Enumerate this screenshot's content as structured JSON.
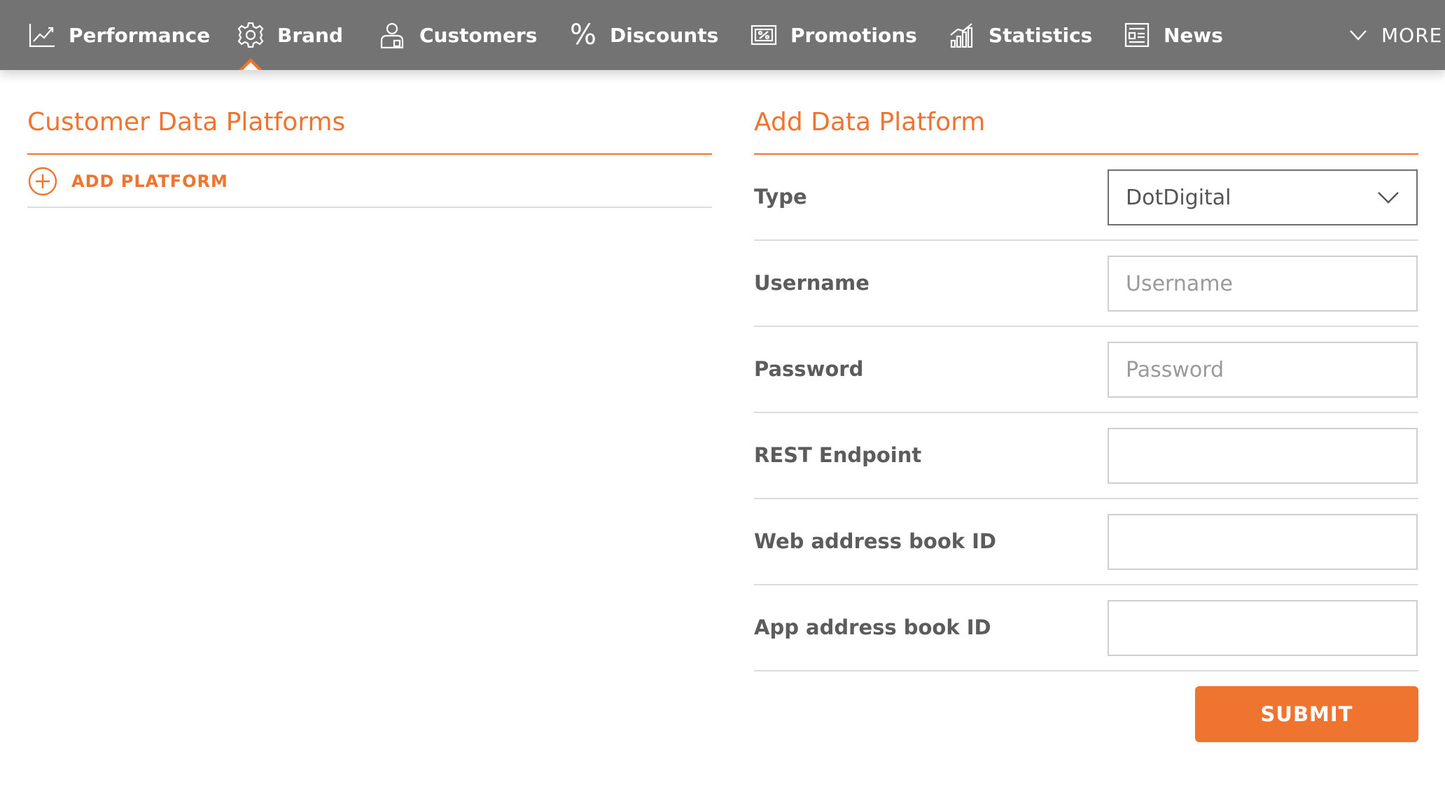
{
  "nav": {
    "items": [
      {
        "label": "Performance",
        "icon": "chart-line-icon"
      },
      {
        "label": "Brand",
        "icon": "gear-icon"
      },
      {
        "label": "Customers",
        "icon": "customer-icon"
      },
      {
        "label": "Discounts",
        "icon": "percent-icon"
      },
      {
        "label": "Promotions",
        "icon": "promotion-ticket-icon"
      },
      {
        "label": "Statistics",
        "icon": "bar-chart-icon"
      },
      {
        "label": "News",
        "icon": "news-icon"
      }
    ],
    "active": "Brand",
    "more_label": "MORE"
  },
  "left_panel": {
    "title": "Customer Data Platforms",
    "add_label": "ADD PLATFORM"
  },
  "form": {
    "title": "Add Data Platform",
    "type_label": "Type",
    "type_value": "DotDigital",
    "username_label": "Username",
    "username_placeholder": "Username",
    "password_label": "Password",
    "password_placeholder": "Password",
    "rest_label": "REST Endpoint",
    "web_book_label": "Web address book ID",
    "app_book_label": "App address book ID",
    "submit_label": "SUBMIT"
  },
  "colors": {
    "accent": "#ee7430",
    "nav_bg": "#737373"
  }
}
